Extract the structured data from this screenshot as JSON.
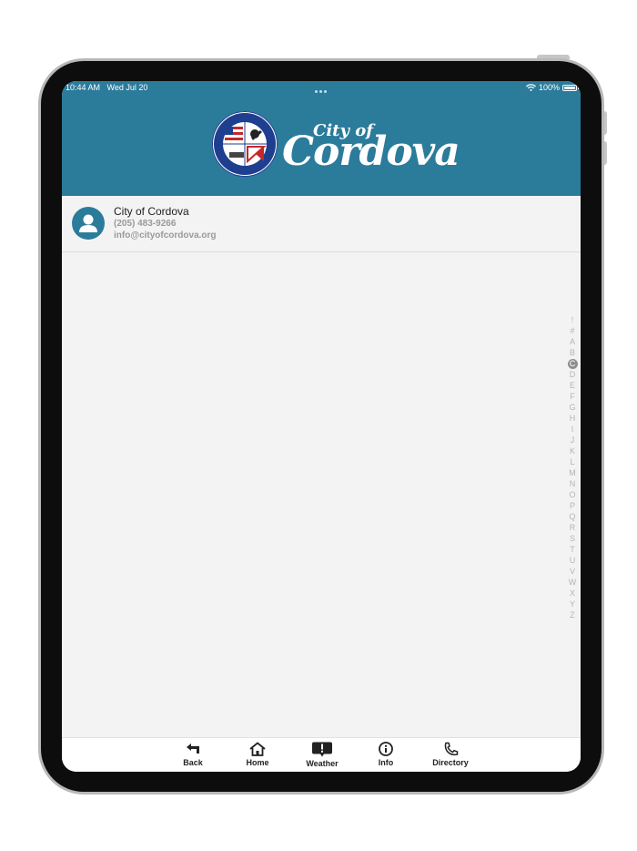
{
  "status_bar": {
    "time": "10:44 AM",
    "date": "Wed Jul 20",
    "battery": "100%"
  },
  "header": {
    "logo_small": "City of",
    "logo_big": "Cordova",
    "background_color": "#2b7b9b"
  },
  "contacts": [
    {
      "name": "City of Cordova",
      "phone": "(205) 483-9266",
      "email": "info@cityofcordova.org"
    }
  ],
  "index_letters": [
    "!",
    "#",
    "A",
    "B",
    "C",
    "D",
    "E",
    "F",
    "G",
    "H",
    "I",
    "J",
    "K",
    "L",
    "M",
    "N",
    "O",
    "P",
    "Q",
    "R",
    "S",
    "T",
    "U",
    "V",
    "W",
    "X",
    "Y",
    "Z"
  ],
  "index_active": "C",
  "tabs": [
    {
      "label": "Back",
      "icon": "back-arrow-icon"
    },
    {
      "label": "Home",
      "icon": "home-icon"
    },
    {
      "label": "Weather",
      "icon": "weather-alert-icon"
    },
    {
      "label": "Info",
      "icon": "info-icon"
    },
    {
      "label": "Directory",
      "icon": "phone-icon"
    }
  ]
}
